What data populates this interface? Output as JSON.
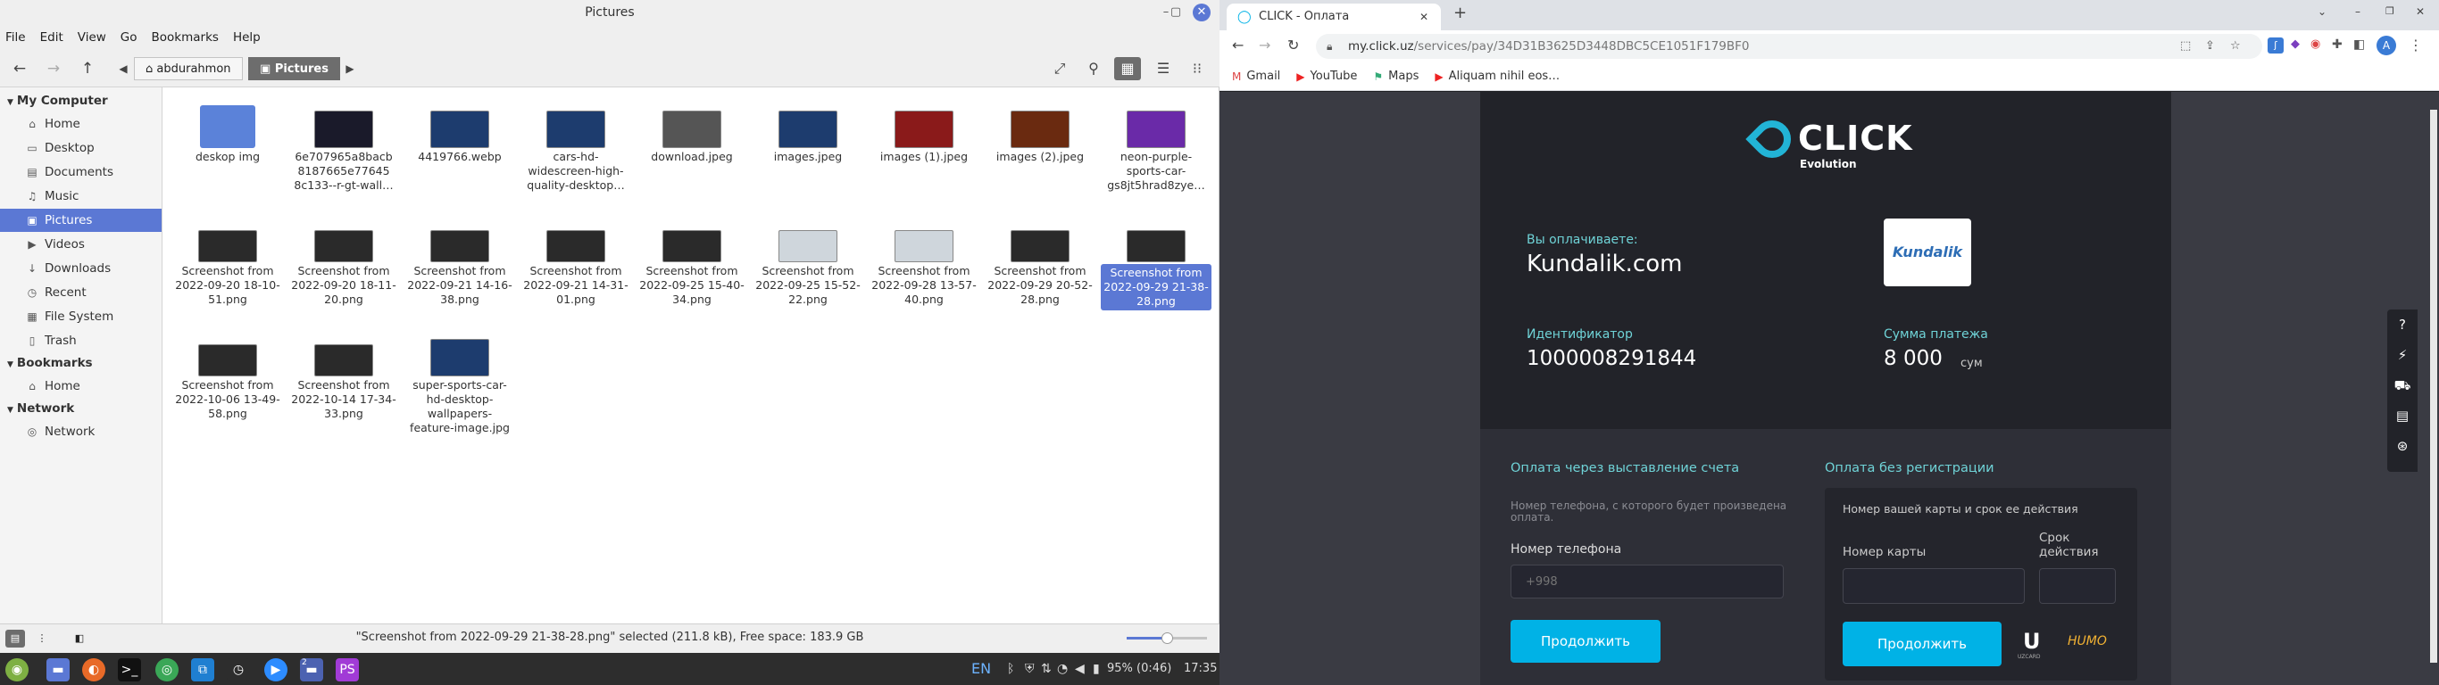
{
  "nemo": {
    "title": "Pictures",
    "menu": [
      "File",
      "Edit",
      "View",
      "Go",
      "Bookmarks",
      "Help"
    ],
    "crumbs": {
      "home": "abdurahmon",
      "current": "Pictures"
    },
    "sidebar": {
      "sections": [
        {
          "title": "My Computer",
          "items": [
            {
              "label": "Home",
              "icon": "home-icon"
            },
            {
              "label": "Desktop",
              "icon": "folder-icon"
            },
            {
              "label": "Documents",
              "icon": "document-icon"
            },
            {
              "label": "Music",
              "icon": "music-icon"
            },
            {
              "label": "Pictures",
              "icon": "picture-icon",
              "selected": true
            },
            {
              "label": "Videos",
              "icon": "video-icon"
            },
            {
              "label": "Downloads",
              "icon": "download-icon"
            },
            {
              "label": "Recent",
              "icon": "clock-icon"
            },
            {
              "label": "File System",
              "icon": "drive-icon"
            },
            {
              "label": "Trash",
              "icon": "trash-icon"
            }
          ]
        },
        {
          "title": "Bookmarks",
          "items": [
            {
              "label": "Home",
              "icon": "home-icon"
            }
          ]
        },
        {
          "title": "Network",
          "items": [
            {
              "label": "Network",
              "icon": "network-icon"
            }
          ]
        }
      ]
    },
    "files": [
      {
        "name": "deskop img",
        "kind": "folder"
      },
      {
        "name": "6e707965a8bacb 8187665e77645 8c133--r-gt-wall…",
        "kind": "dark"
      },
      {
        "name": "4419766.webp",
        "kind": "blue"
      },
      {
        "name": "cars-hd- widescreen-high- quality-desktop…",
        "kind": "blue"
      },
      {
        "name": "download.jpeg",
        "kind": "gray"
      },
      {
        "name": "images.jpeg",
        "kind": "blue"
      },
      {
        "name": "images (1).jpeg",
        "kind": "red"
      },
      {
        "name": "images (2).jpeg",
        "kind": "orange"
      },
      {
        "name": "neon-purple- sports-car- gs8jt5hrad8zye…",
        "kind": "purple"
      },
      {
        "name": "Screenshot from 2022-09-20 18-10-51.png",
        "kind": "shot"
      },
      {
        "name": "Screenshot from 2022-09-20 18-11-20.png",
        "kind": "shot"
      },
      {
        "name": "Screenshot from 2022-09-21 14-16-38.png",
        "kind": "shot"
      },
      {
        "name": "Screenshot from 2022-09-21 14-31-01.png",
        "kind": "shot"
      },
      {
        "name": "Screenshot from 2022-09-25 15-40-34.png",
        "kind": "shot"
      },
      {
        "name": "Screenshot from 2022-09-25 15-52-22.png",
        "kind": "light"
      },
      {
        "name": "Screenshot from 2022-09-28 13-57-40.png",
        "kind": "light"
      },
      {
        "name": "Screenshot from 2022-09-29 20-52-28.png",
        "kind": "shot"
      },
      {
        "name": "Screenshot from 2022-09-29 21-38-28.png",
        "kind": "shot",
        "selected": true
      },
      {
        "name": "Screenshot from 2022-10-06 13-49-58.png",
        "kind": "shot"
      },
      {
        "name": "Screenshot from 2022-10-14 17-34-33.png",
        "kind": "shot"
      },
      {
        "name": "super-sports-car- hd-desktop- wallpapers- feature-image.jpg",
        "kind": "blue"
      }
    ],
    "status": "\"Screenshot from 2022-09-29 21-38-28.png\" selected (211.8 kB), Free space: 183.9 GB",
    "zoom_level": 0.5
  },
  "taskbar": {
    "lang": "EN",
    "battery": "95% (0:46)",
    "time": "17:35",
    "workspace": "2"
  },
  "chrome": {
    "tab_title": "CLICK - Оплата",
    "url_host": "my.click.uz",
    "url_path": "/services/pay/34D31B3625D3448DBC5CE1051F179BF0",
    "bookmarks": [
      {
        "label": "Gmail",
        "icon": "gmail-icon"
      },
      {
        "label": "YouTube",
        "icon": "youtube-icon"
      },
      {
        "label": "Maps",
        "icon": "maps-icon"
      },
      {
        "label": "Aliquam nihil eos…",
        "icon": "youtube-icon"
      }
    ],
    "profile_initial": "A"
  },
  "click": {
    "brand": "CLICK",
    "brand_sub": "Evolution",
    "paying_label": "Вы оплачиваете:",
    "merchant": "Kundalik.com",
    "merchant_logo": "Kundalik",
    "id_label": "Идентификатор",
    "id_value": "1000008291844",
    "sum_label": "Сумма платежа",
    "sum_value": "8 000",
    "sum_unit": "сум",
    "invoice_title": "Оплата через выставление счета",
    "invoice_hint": "Номер телефона, с которого будет произведена оплата.",
    "phone_label": "Номер телефона",
    "phone_placeholder": "+998",
    "continue": "Продолжить",
    "noreg_title": "Оплата без регистрации",
    "card_hint": "Номер вашей карты и срок ее действия",
    "card_number_label": "Номер карты",
    "card_expiry_label": "Срок действия",
    "uzcard": "UZCARD",
    "humo": "HUMO"
  }
}
